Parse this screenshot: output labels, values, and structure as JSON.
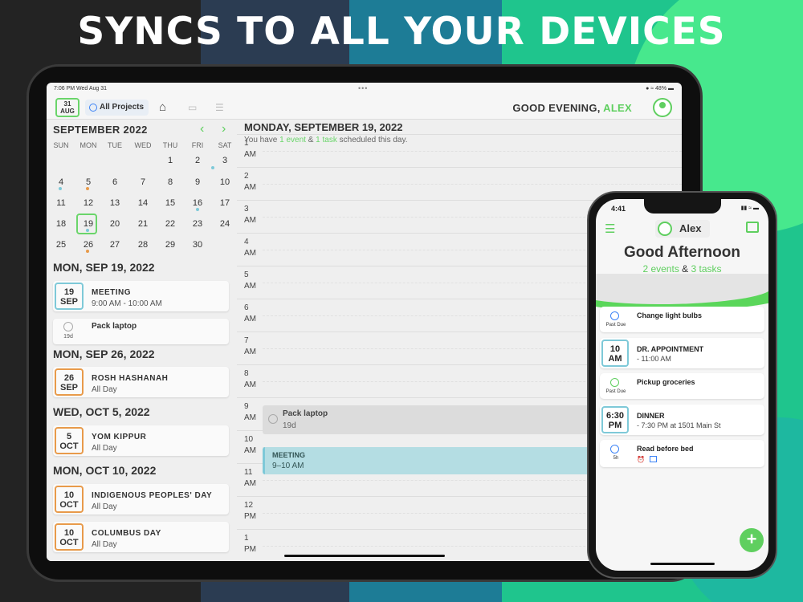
{
  "headline": "SYNCS TO ALL YOUR DEVICES",
  "colors": {
    "accent": "#5fcf5f",
    "event_blue": "#7ec9d8",
    "holiday_orange": "#e89a4a"
  },
  "tablet": {
    "status": {
      "time": "7:06 PM  Wed Aug 31",
      "battery": "● ≈ 48% ▬"
    },
    "toolbar": {
      "date_day": "31",
      "date_month": "AUG",
      "projects_label": "All Projects",
      "greeting_prefix": "GOOD EVENING,",
      "greeting_name": "ALEX"
    },
    "calendar": {
      "month_title": "SEPTEMBER 2022",
      "weekdays": [
        "SUN",
        "MON",
        "TUE",
        "WED",
        "THU",
        "FRI",
        "SAT"
      ],
      "weeks": [
        [
          "",
          "",
          "",
          "",
          "1",
          "2",
          "3"
        ],
        [
          "4",
          "5",
          "6",
          "7",
          "8",
          "9",
          "10"
        ],
        [
          "11",
          "12",
          "13",
          "14",
          "15",
          "16",
          "17"
        ],
        [
          "18",
          "19",
          "20",
          "21",
          "22",
          "23",
          "24"
        ],
        [
          "25",
          "26",
          "27",
          "28",
          "29",
          "30",
          ""
        ]
      ]
    },
    "agenda": [
      {
        "heading": "MON, SEP 19, 2022",
        "items": [
          {
            "day": "19",
            "month": "SEP",
            "title": "MEETING",
            "sub": "9:00 AM - 10:00 AM"
          },
          {
            "task": "Pack laptop",
            "due": "19d"
          }
        ]
      },
      {
        "heading": "MON, SEP 26, 2022",
        "items": [
          {
            "day": "26",
            "month": "SEP",
            "title": "ROSH HASHANAH",
            "sub": "All Day"
          }
        ]
      },
      {
        "heading": "WED, OCT 5, 2022",
        "items": [
          {
            "day": "5",
            "month": "OCT",
            "title": "YOM KIPPUR",
            "sub": "All Day"
          }
        ]
      },
      {
        "heading": "MON, OCT 10, 2022",
        "items": [
          {
            "day": "10",
            "month": "OCT",
            "title": "INDIGENOUS PEOPLES' DAY",
            "sub": "All Day"
          },
          {
            "day": "10",
            "month": "OCT",
            "title": "COLUMBUS DAY",
            "sub": "All Day"
          }
        ]
      }
    ],
    "day": {
      "title": "MONDAY, SEPTEMBER 19, 2022",
      "sub_prefix": "You have",
      "sub_event": "1 event",
      "sub_amp": "&",
      "sub_task": "1 task",
      "sub_suffix": "scheduled this day.",
      "hours": [
        {
          "h": "1",
          "p": "AM"
        },
        {
          "h": "2",
          "p": "AM"
        },
        {
          "h": "3",
          "p": "AM"
        },
        {
          "h": "4",
          "p": "AM"
        },
        {
          "h": "5",
          "p": "AM"
        },
        {
          "h": "6",
          "p": "AM"
        },
        {
          "h": "7",
          "p": "AM"
        },
        {
          "h": "8",
          "p": "AM"
        },
        {
          "h": "9",
          "p": "AM"
        },
        {
          "h": "10",
          "p": "AM"
        },
        {
          "h": "11",
          "p": "AM"
        },
        {
          "h": "12",
          "p": "PM"
        },
        {
          "h": "1",
          "p": "PM"
        }
      ],
      "task_title": "Pack laptop",
      "task_due": "19d",
      "event_title": "MEETING",
      "event_time": "9–10 AM"
    }
  },
  "phone": {
    "time": "4:41",
    "status": "▮▮ ≈ ▬",
    "user": "Alex",
    "greeting": "Good Afternoon",
    "count_events": "2 events",
    "count_amp": "&",
    "count_tasks": "3 tasks",
    "items": [
      {
        "kind": "task",
        "title": "Change light bulbs",
        "label": "Past Due",
        "check": "blue"
      },
      {
        "kind": "event",
        "day": "10",
        "period": "AM",
        "title": "DR. APPOINTMENT",
        "sub": "- 11:00 AM"
      },
      {
        "kind": "task",
        "title": "Pickup groceries",
        "label": "Past Due",
        "check": "green"
      },
      {
        "kind": "event",
        "day": "6:30",
        "period": "PM",
        "title": "DINNER",
        "sub": "- 7:30 PM at 1501 Main St"
      },
      {
        "kind": "task",
        "title": "Read before bed",
        "label": "5h",
        "check": "blue"
      }
    ],
    "fab": "+"
  }
}
